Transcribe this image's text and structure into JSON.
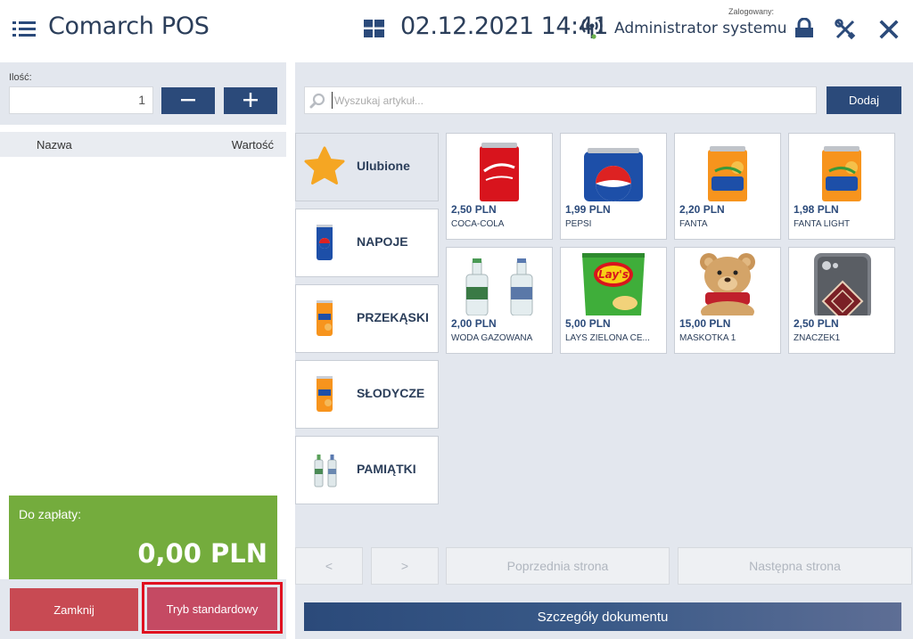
{
  "header": {
    "app_title": "Comarch POS",
    "datetime": "02.12.2021 14:41",
    "logged_label": "Zalogowany:",
    "user_name": "Administrator systemu"
  },
  "quantity": {
    "label": "Ilość:",
    "value": "1",
    "minus_label": "−",
    "plus_label": "+"
  },
  "items_table": {
    "col_name": "Nazwa",
    "col_value": "Wartość",
    "rows": []
  },
  "payment": {
    "label": "Do zapłaty:",
    "amount": "0,00 PLN"
  },
  "actions": {
    "close_label": "Zamknij",
    "mode_label": "Tryb standardowy"
  },
  "search": {
    "placeholder": "Wyszukaj artykuł...",
    "add_label": "Dodaj"
  },
  "categories": [
    {
      "label": "Ulubione",
      "icon": "star-icon",
      "active": true
    },
    {
      "label": "NAPOJE",
      "icon": "pepsi-can-icon"
    },
    {
      "label": "PRZEKĄSKI",
      "icon": "fanta-can-icon"
    },
    {
      "label": "SŁODYCZE",
      "icon": "fanta-can-icon"
    },
    {
      "label": "PAMIĄTKI",
      "icon": "water-bottles-icon"
    }
  ],
  "products": [
    {
      "price": "2,50 PLN",
      "name": "COCA-COLA"
    },
    {
      "price": "1,99 PLN",
      "name": "PEPSI"
    },
    {
      "price": "2,20 PLN",
      "name": "FANTA"
    },
    {
      "price": "1,98 PLN",
      "name": "FANTA LIGHT"
    },
    {
      "price": "2,00 PLN",
      "name": "WODA GAZOWANA"
    },
    {
      "price": "5,00 PLN",
      "name": "LAYS ZIELONA CE..."
    },
    {
      "price": "15,00 PLN",
      "name": "MASKOTKA 1"
    },
    {
      "price": "2,50 PLN",
      "name": "ZNACZEK1"
    }
  ],
  "pagination": {
    "prev_small": "<",
    "next_small": ">",
    "prev_page": "Poprzednia strona",
    "next_page": "Następna strona"
  },
  "document_details": "Szczegóły dokumentu",
  "colors": {
    "primary": "#2b4a7a",
    "pay_green": "#74ac3d",
    "close_red": "#c84a53",
    "highlight": "#e01020"
  }
}
